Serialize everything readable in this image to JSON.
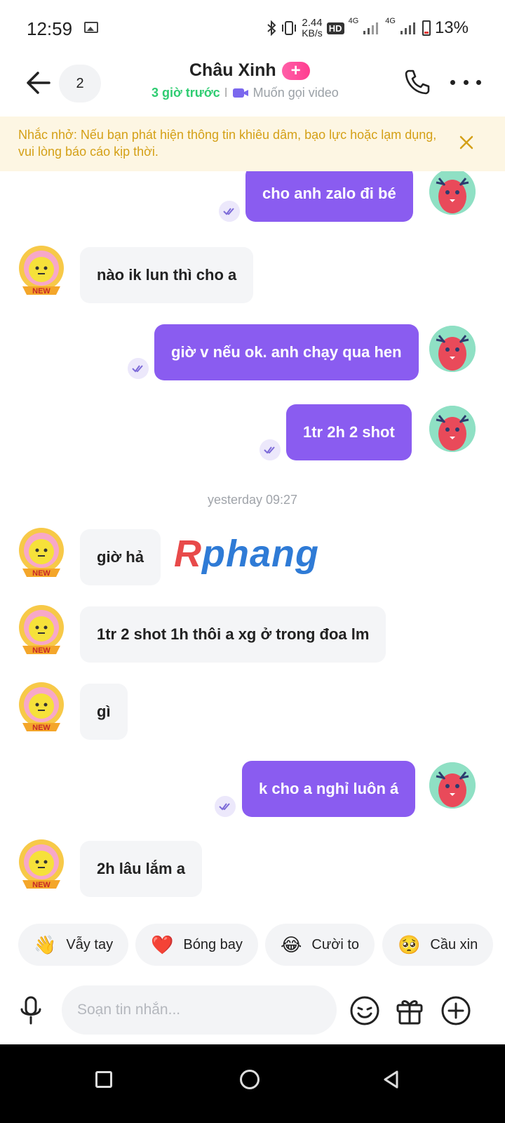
{
  "status_bar": {
    "time": "12:59",
    "speed_value": "2.44",
    "speed_unit": "KB/s",
    "hd": "HD",
    "net1": "4G",
    "net2": "4G",
    "battery": "13%"
  },
  "header": {
    "back_count": "2",
    "name": "Châu Xinh",
    "plus": "+",
    "last_seen": "3 giờ trước",
    "separator": "I",
    "video_call": "Muốn gọi video"
  },
  "notice": {
    "text": "Nhắc nhở: Nếu bạn phát hiện thông tin khiêu dâm, bạo lực hoặc lạm dụng, vui lòng báo cáo kịp thời."
  },
  "messages": [
    {
      "side": "out",
      "text": "cho anh zalo đi bé"
    },
    {
      "side": "in",
      "text": "nào ik lun thì cho a"
    },
    {
      "side": "out",
      "text": "giờ v nếu ok. anh chạy qua hen"
    },
    {
      "side": "out",
      "text": "1tr 2h 2 shot"
    },
    {
      "side": "in",
      "text": "giờ hả"
    },
    {
      "side": "in",
      "text": "1tr 2 shot 1h thôi a xg ở trong đoa lm"
    },
    {
      "side": "in",
      "text": "gì"
    },
    {
      "side": "out",
      "text": "k cho a nghỉ luôn á"
    },
    {
      "side": "in",
      "text": "2h lâu lắm a"
    }
  ],
  "time_separator": "yesterday 09:27",
  "watermark": {
    "part1": "R",
    "part2": "phang"
  },
  "avatar_badge": "NEW",
  "quick_replies": [
    {
      "emoji": "👋",
      "label": "Vẫy tay"
    },
    {
      "emoji": "❤️",
      "label": "Bóng bay"
    },
    {
      "emoji": "😂",
      "label": "Cười to"
    },
    {
      "emoji": "🥺",
      "label": "Cầu xin"
    }
  ],
  "input": {
    "placeholder": "Soạn tin nhắn..."
  },
  "colors": {
    "outgoing_bubble": "#8a5cf0",
    "incoming_bubble": "#f4f5f7",
    "online_green": "#2ecc71",
    "notice_bg": "#fdf6e3",
    "notice_text": "#d4a017",
    "plus_pink": "#ff4f9a"
  }
}
